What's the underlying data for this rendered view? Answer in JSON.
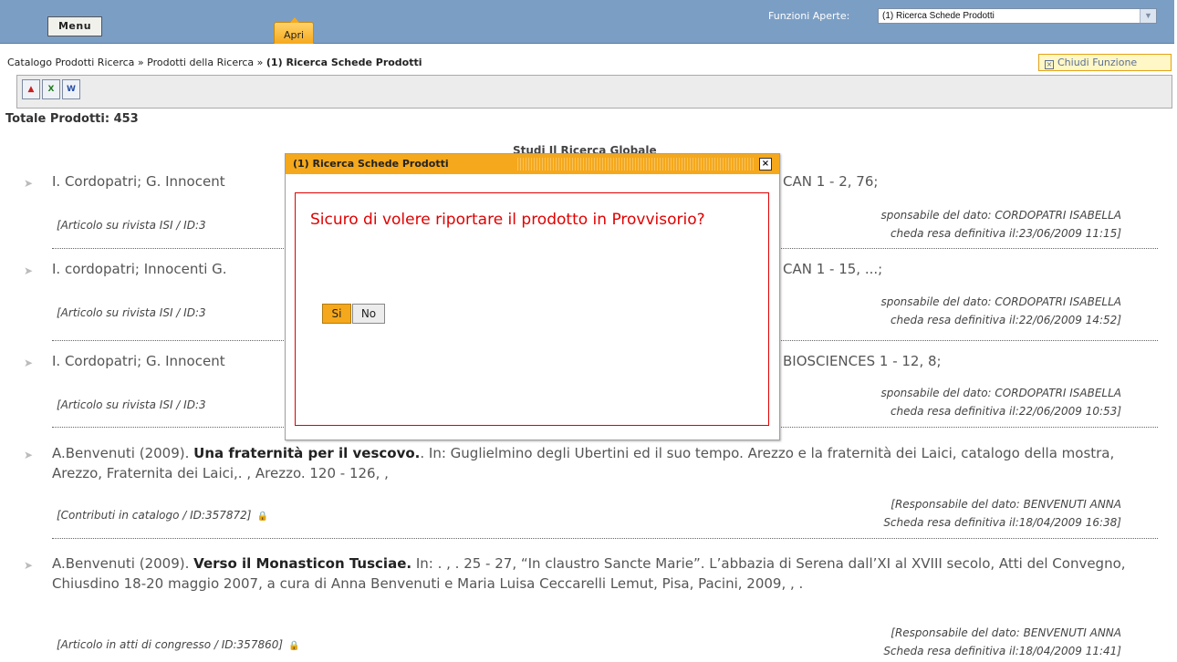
{
  "header": {
    "menu_label": "Menu",
    "apri_label": "Apri",
    "funzioni_label": "Funzioni Aperte:",
    "funzioni_value": "(1) Ricerca Schede Prodotti"
  },
  "breadcrumb": {
    "part1": "Catalogo Prodotti Ricerca",
    "sep": "»",
    "part2": "Prodotti della Ricerca",
    "current": "(1) Ricerca Schede Prodotti"
  },
  "chiudi_label": "Chiudi Funzione",
  "toolbar": {
    "icons": [
      "pdf-export",
      "excel-export",
      "word-export"
    ]
  },
  "totale": "Totale Prodotti: 453",
  "items": [
    {
      "cit_html_left": "I. Cordopatri; G. Innocent",
      "cit_right": "CAN 1 - 2, 76;",
      "meta_left": "[Articolo su rivista ISI / ID:3",
      "resp": "sponsabile del dato: CORDOPATRI ISABELLA",
      "def": "cheda resa definitiva il:23/06/2009 11:15]"
    },
    {
      "cit_html_left": "I. cordopatri; Innocenti G.",
      "cit_right": "CAN 1 - 15, ...;",
      "meta_left": "[Articolo su rivista ISI / ID:3",
      "resp": "sponsabile del dato: CORDOPATRI ISABELLA",
      "def": "cheda resa definitiva il:22/06/2009 14:52]"
    },
    {
      "cit_html_left": "I. Cordopatri; G. Innocent",
      "cit_right": "BIOSCIENCES 1 - 12, 8;",
      "meta_left": "[Articolo su rivista ISI / ID:3",
      "resp": "sponsabile del dato: CORDOPATRI ISABELLA",
      "def": "cheda resa definitiva il:22/06/2009 10:53]"
    },
    {
      "author": "A.Benvenuti (2009).",
      "title": "Una fraternità per il vescovo.",
      "rest": ". In: Guglielmino degli Ubertini ed il suo tempo. Arezzo e la fraternità dei Laici, catalogo della mostra, Arezzo, Fraternita dei Laici,. , Arezzo. 120 - 126, ,",
      "meta_left": "[Contributi in catalogo / ID:357872]",
      "resp": "[Responsabile del dato: BENVENUTI ANNA",
      "def": "Scheda resa definitiva il:18/04/2009 16:38]"
    },
    {
      "author": "A.Benvenuti (2009).",
      "title": "Verso il Monasticon Tusciae.",
      "rest": " In: . , . 25 - 27, “In claustro Sancte Marie”. L’abbazia di Serena dall’XI al XVIII secolo, Atti del Convegno, Chiusdino 18-20 maggio 2007, a cura di Anna Benvenuti e Maria Luisa Ceccarelli Lemut, Pisa, Pacini, 2009, , .",
      "meta_left": "[Articolo in atti di congresso / ID:357860]",
      "resp": "[Responsabile del dato: BENVENUTI ANNA",
      "def": "Scheda resa definitiva il:18/04/2009 11:41]"
    }
  ],
  "hidden_heading": "Studi Il Ricerca Globale",
  "modal": {
    "title": "(1) Ricerca Schede Prodotti",
    "close": "×",
    "message": "Sicuro di volere riportare il prodotto in Provvisorio?",
    "yes": "Si",
    "no": "No"
  },
  "colors": {
    "topbar": "#7b9ec5",
    "accent_orange": "#f5a81c",
    "error_red": "#e00000"
  }
}
